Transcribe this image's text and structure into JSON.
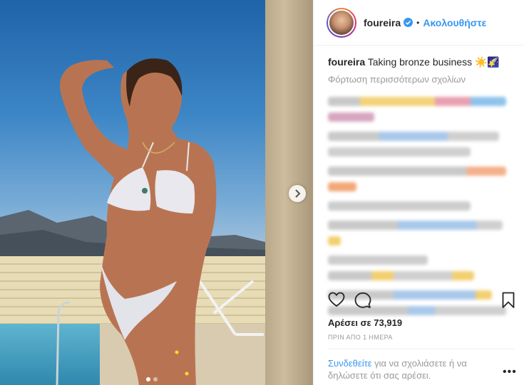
{
  "post": {
    "username": "foureira",
    "follow_label": "Ακολουθήστε",
    "bullet": "•",
    "caption_user": "foureira",
    "caption_text": "Taking bronze business",
    "caption_emoji": "☀️🌠",
    "load_more_label": "Φόρτωση περισσότερων σχολίων",
    "likes_label": "Αρέσει σε",
    "likes_count": "73,919",
    "timestamp": "ΠΡΙΝ ΑΠΟ 1 ΗΜΕΡΑ",
    "login_link": "Συνδεθείτε",
    "login_text": " για να σχολιάσετε ή να δηλώσετε ότι σας αρέσει.",
    "more_label": "•••"
  },
  "colors": {
    "link": "#3897f0",
    "verified": "#3897f0",
    "muted": "#999999"
  },
  "icons": {
    "verified": "verified-badge-icon",
    "like": "heart-icon",
    "comment": "comment-bubble-icon",
    "save": "bookmark-icon",
    "next": "chevron-right-icon"
  }
}
